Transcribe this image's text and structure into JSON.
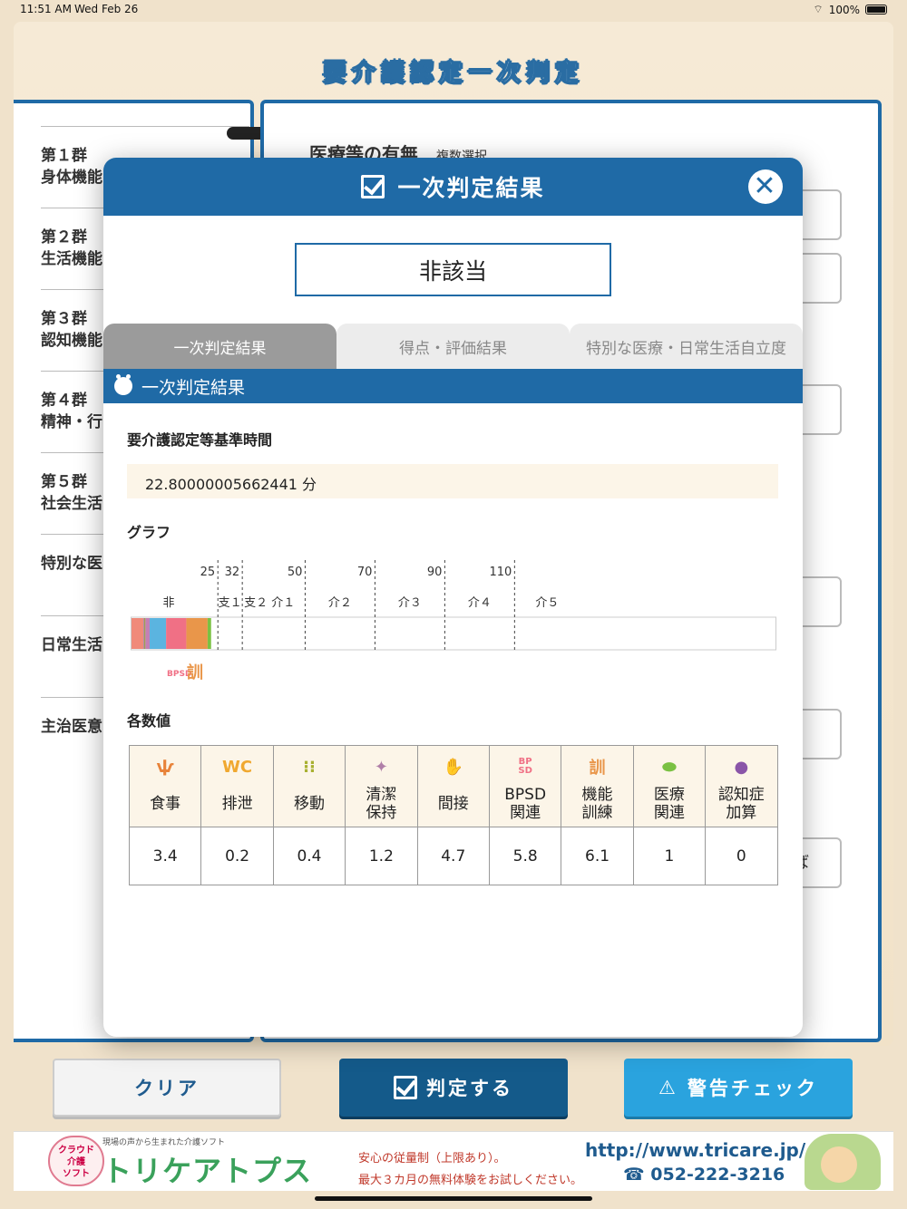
{
  "status": {
    "time": "11:51 AM",
    "date": "Wed Feb 26",
    "battery": "100%"
  },
  "app_title": "要介護認定一次判定",
  "left_nav": [
    {
      "l1": "第１群",
      "l2": "身体機能"
    },
    {
      "l1": "第２群",
      "l2": "生活機能"
    },
    {
      "l1": "第３群",
      "l2": "認知機能"
    },
    {
      "l1": "第４群",
      "l2": "精神・行"
    },
    {
      "l1": "第５群",
      "l2": "社会生活"
    },
    {
      "l1": "特別な医",
      "l2": ""
    },
    {
      "l1": "日常生活",
      "l2": ""
    },
    {
      "l1": "主治医意",
      "l2": ""
    }
  ],
  "right_panel": {
    "heading": "医療等の有無",
    "sub": "複数選択",
    "box_text_1": "）",
    "box_text_2": "れば"
  },
  "modal": {
    "title": "一次判定結果",
    "result": "非該当",
    "tabs": [
      "一次判定結果",
      "得点・評価結果",
      "特別な医療・日常生活自立度"
    ],
    "section": "一次判定結果",
    "time_label": "要介護認定等基準時間",
    "time_value": "22.80000005662441 分",
    "graph_label": "グラフ",
    "values_label": "各数値"
  },
  "chart_data": {
    "type": "bar",
    "thresholds": [
      25,
      32,
      50,
      70,
      90,
      110
    ],
    "threshold_labels": [
      "25",
      "32",
      "50",
      "70",
      "90",
      "110"
    ],
    "band_labels": [
      "非",
      "支１",
      "支２ 介１",
      "介２",
      "介３",
      "介４",
      "介５"
    ],
    "xlim": [
      0,
      185
    ],
    "segments": [
      {
        "name": "食事",
        "value": 3.4,
        "color": "#f08a7a"
      },
      {
        "name": "排泄",
        "value": 0.2,
        "color": "#9b6fa8"
      },
      {
        "name": "移動",
        "value": 0.4,
        "color": "#a0a050"
      },
      {
        "name": "清潔保持",
        "value": 1.2,
        "color": "#c47fb5"
      },
      {
        "name": "間接",
        "value": 4.7,
        "color": "#5bb4e0"
      },
      {
        "name": "BPSD関連",
        "value": 5.8,
        "color": "#f07085"
      },
      {
        "name": "機能訓練",
        "value": 6.1,
        "color": "#e9964a"
      },
      {
        "name": "医療関連",
        "value": 1,
        "color": "#7ac143"
      },
      {
        "name": "認知症加算",
        "value": 0,
        "color": "#8a55a8"
      }
    ],
    "legend_marks": [
      "BPSD",
      "訓"
    ]
  },
  "values_table": [
    {
      "icon": "fork-knife-icon",
      "glyph": "ѱ",
      "color": "#e8833a",
      "label": "食事",
      "value": "3.4"
    },
    {
      "icon": "wc-icon",
      "glyph": "WC",
      "color": "#f0a830",
      "label": "排泄",
      "value": "0.2"
    },
    {
      "icon": "footprints-icon",
      "glyph": "⁝⁝",
      "color": "#a8b030",
      "label": "移動",
      "value": "0.4"
    },
    {
      "icon": "sparkle-icon",
      "glyph": "✦",
      "color": "#b07fa8",
      "label": "清潔\n保持",
      "value": "1.2"
    },
    {
      "icon": "handshake-icon",
      "glyph": "✋",
      "color": "#3aa0d8",
      "label": "間接",
      "value": "4.7"
    },
    {
      "icon": "bpsd-icon",
      "glyph": "BP\nSD",
      "color": "#f07085",
      "label": "BPSD\n関連",
      "value": "5.8"
    },
    {
      "icon": "training-icon",
      "glyph": "訓",
      "color": "#e9964a",
      "label": "機能\n訓練",
      "value": "6.1"
    },
    {
      "icon": "pill-icon",
      "glyph": "⬬",
      "color": "#7ac143",
      "label": "医療\n関連",
      "value": "1"
    },
    {
      "icon": "brain-icon",
      "glyph": "●",
      "color": "#8a55a8",
      "label": "認知症\n加算",
      "value": "0"
    }
  ],
  "buttons": {
    "clear": "クリア",
    "judge": "判定する",
    "warn": "警告チェック"
  },
  "banner": {
    "badge": "クラウド\n(ASP・SaaS)\n介護\nソフト",
    "sub": "現場の声から生まれた介護ソフト",
    "logo": "トリケアトプス",
    "line1": "安心の従量制（上限あり）。",
    "line2": "最大３カ月の無料体験をお試しください。",
    "url": "http://www.tricare.jp/",
    "tel": "☎ 052-222-3216"
  }
}
